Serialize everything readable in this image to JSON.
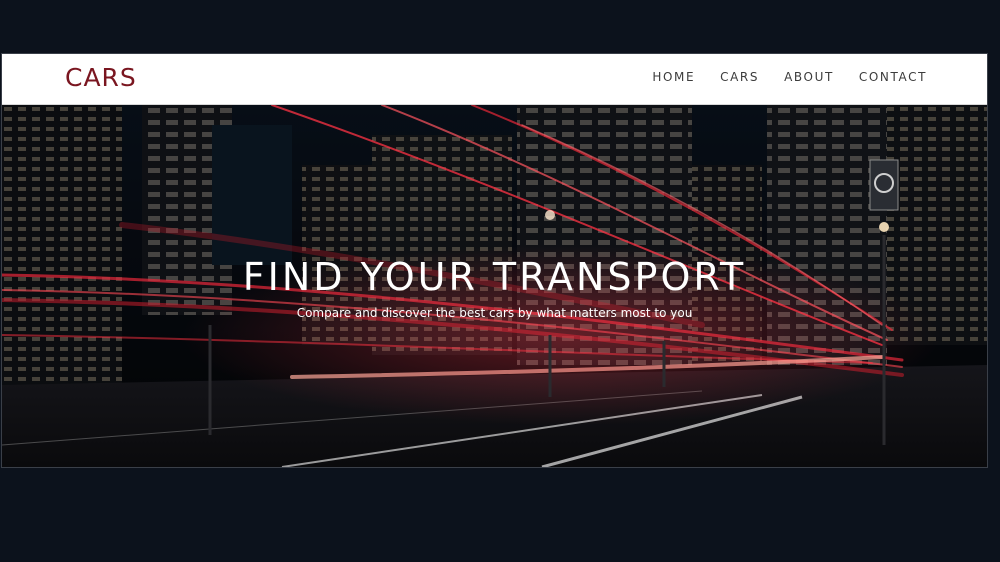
{
  "navbar": {
    "brand": "CARS",
    "links": [
      {
        "label": "HOME"
      },
      {
        "label": "CARS"
      },
      {
        "label": "ABOUT"
      },
      {
        "label": "CONTACT"
      }
    ]
  },
  "hero": {
    "title": "FIND YOUR TRANSPORT",
    "subtitle": "Compare and discover the best cars by what matters most to you",
    "background": "night city street with red light trails"
  },
  "colors": {
    "page_background": "#0c121c",
    "brand": "#7a1620",
    "navbar_background": "#ffffff",
    "nav_text": "#3c3c3c",
    "hero_text": "#ffffff",
    "light_trail": "#e8283a"
  }
}
